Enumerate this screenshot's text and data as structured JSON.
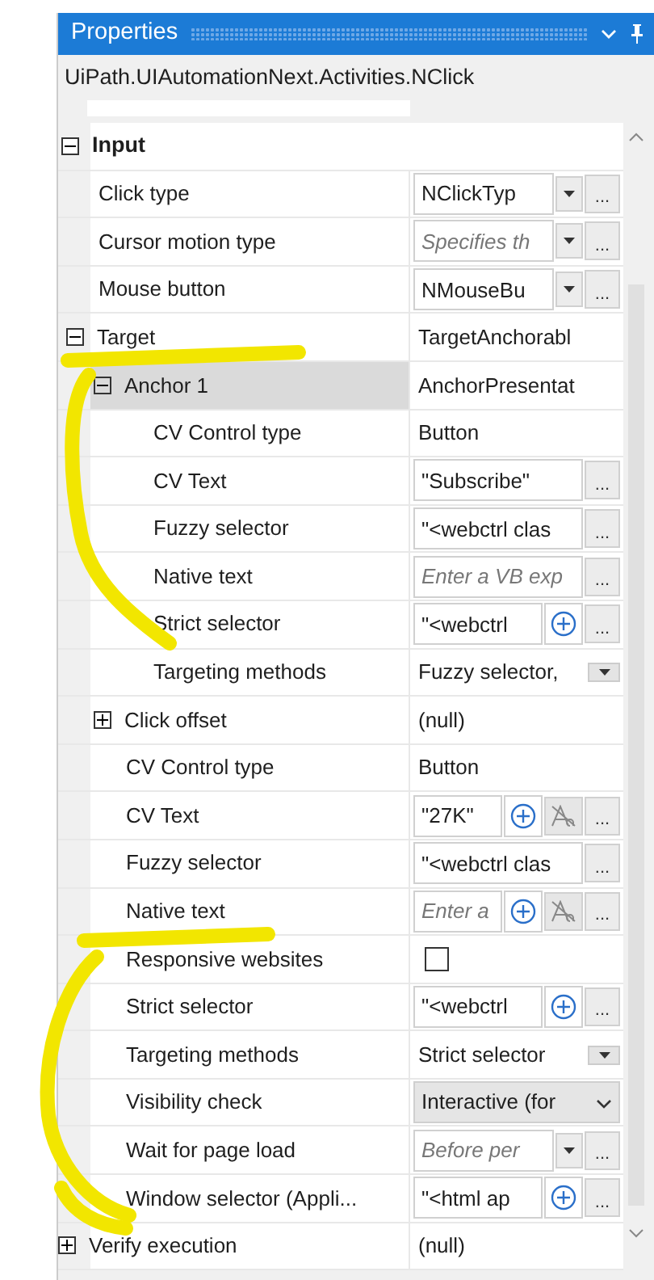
{
  "panel": {
    "title": "Properties",
    "subtitle": "UiPath.UIAutomationNext.Activities.NClick"
  },
  "groups": [
    {
      "label": "Input",
      "kind": "category",
      "expanded": true,
      "selected": false,
      "children": [
        {
          "label": "Click type",
          "selected": false,
          "kind": "field",
          "value": "NClickTyp",
          "buttons": [
            {
              "kind": "dropdown"
            },
            {
              "kind": "ellipsis",
              "label": "..."
            }
          ]
        },
        {
          "label": "Cursor motion type",
          "selected": false,
          "kind": "field",
          "placeholder": "Specifies th",
          "buttons": [
            {
              "kind": "dropdown"
            },
            {
              "kind": "ellipsis",
              "label": "..."
            }
          ]
        },
        {
          "label": "Mouse button",
          "selected": false,
          "kind": "field",
          "value": "NMouseBu",
          "buttons": [
            {
              "kind": "dropdown"
            },
            {
              "kind": "ellipsis",
              "label": "..."
            }
          ]
        },
        {
          "label": "Target",
          "selected": false,
          "expanded": true,
          "kind": "text",
          "value": "TargetAnchorabl",
          "children": [
            {
              "label": "Anchor 1",
              "selected": true,
              "expanded": true,
              "kind": "text",
              "value": "AnchorPresentat",
              "children": [
                {
                  "label": "CV Control type",
                  "selected": false,
                  "kind": "text",
                  "value": "Button"
                },
                {
                  "label": "CV Text",
                  "selected": false,
                  "kind": "field",
                  "value": "\"Subscribe\"",
                  "buttons": [
                    {
                      "kind": "ellipsis",
                      "label": "..."
                    }
                  ]
                },
                {
                  "label": "Fuzzy selector",
                  "selected": false,
                  "kind": "field",
                  "value": "\"<webctrl clas",
                  "buttons": [
                    {
                      "kind": "ellipsis",
                      "label": "..."
                    }
                  ]
                },
                {
                  "label": "Native text",
                  "selected": false,
                  "kind": "field",
                  "placeholder": "Enter a VB exp",
                  "buttons": [
                    {
                      "kind": "ellipsis",
                      "label": "..."
                    }
                  ]
                },
                {
                  "label": "Strict selector",
                  "selected": false,
                  "kind": "field",
                  "value": "\"<webctrl",
                  "buttons": [
                    {
                      "kind": "plus"
                    },
                    {
                      "kind": "ellipsis",
                      "label": "..."
                    }
                  ]
                },
                {
                  "label": "Targeting methods",
                  "selected": false,
                  "kind": "combo",
                  "value": "Fuzzy selector,"
                }
              ]
            },
            {
              "label": "Click offset",
              "selected": false,
              "expanded": false,
              "kind": "text",
              "value": "(null)"
            },
            {
              "label": "CV Control type",
              "selected": false,
              "kind": "text",
              "value": "Button"
            },
            {
              "label": "CV Text",
              "selected": false,
              "kind": "field",
              "value": "\"27K\"",
              "buttons": [
                {
                  "kind": "plus"
                },
                {
                  "kind": "text-style"
                },
                {
                  "kind": "ellipsis",
                  "label": "..."
                }
              ]
            },
            {
              "label": "Fuzzy selector",
              "selected": false,
              "kind": "field",
              "value": "\"<webctrl clas",
              "buttons": [
                {
                  "kind": "ellipsis",
                  "label": "..."
                }
              ]
            },
            {
              "label": "Native text",
              "selected": false,
              "kind": "field",
              "placeholder": "Enter a",
              "buttons": [
                {
                  "kind": "plus"
                },
                {
                  "kind": "text-style"
                },
                {
                  "kind": "ellipsis",
                  "label": "..."
                }
              ]
            },
            {
              "label": "Responsive websites",
              "selected": false,
              "kind": "checkbox",
              "checked": false
            },
            {
              "label": "Strict selector",
              "selected": false,
              "kind": "field",
              "value": "\"<webctrl",
              "buttons": [
                {
                  "kind": "plus"
                },
                {
                  "kind": "ellipsis",
                  "label": "..."
                }
              ]
            },
            {
              "label": "Targeting methods",
              "selected": false,
              "kind": "combo",
              "value": "Strict selector"
            },
            {
              "label": "Visibility check",
              "selected": false,
              "kind": "select",
              "value": "Interactive (for"
            },
            {
              "label": "Wait for page load",
              "selected": false,
              "kind": "field",
              "placeholder": "Before per",
              "buttons": [
                {
                  "kind": "dropdown"
                },
                {
                  "kind": "ellipsis",
                  "label": "..."
                }
              ]
            },
            {
              "label": "Window selector (Appli...",
              "selected": false,
              "kind": "field",
              "value": "\"<html ap",
              "buttons": [
                {
                  "kind": "plus"
                },
                {
                  "kind": "ellipsis",
                  "label": "..."
                }
              ]
            }
          ]
        }
      ]
    },
    {
      "label": "Verify execution",
      "kind": "text",
      "expanded": false,
      "selected": false,
      "value": "(null)"
    }
  ]
}
